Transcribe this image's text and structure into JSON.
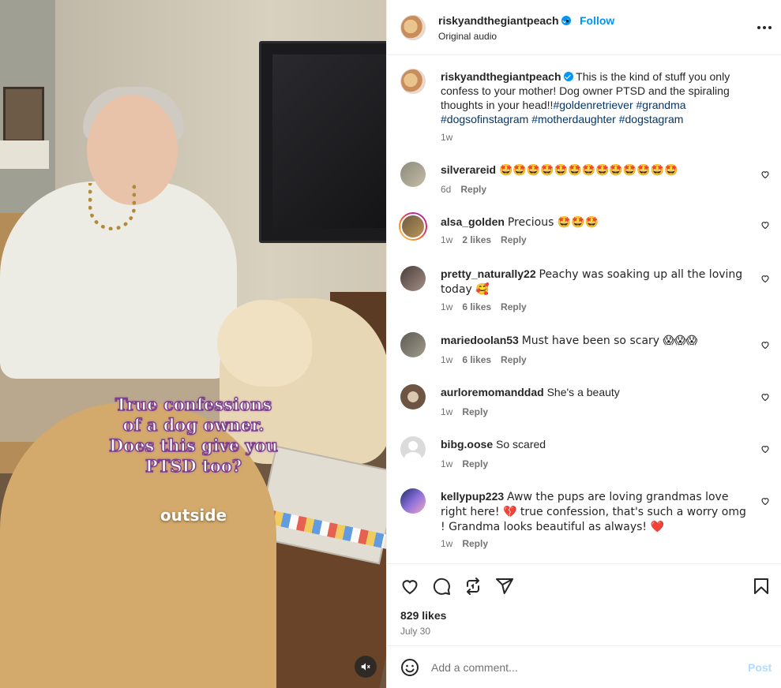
{
  "media": {
    "overlay_text": "True confessions\nof a dog owner.\nDoes this give you\nPTSD too?",
    "overlay_sub": "outside",
    "mute_icon": "speaker-muted-icon"
  },
  "header": {
    "username": "riskyandthegiantpeach",
    "dot": "•",
    "follow_label": "Follow",
    "audio_label": "Original audio"
  },
  "caption": {
    "username": "riskyandthegiantpeach",
    "text": "This is the kind of stuff you only confess to your mother! Dog owner PTSD and the spiraling thoughts in your head!!",
    "hashtags": [
      "#goldenretriever",
      "#grandma",
      "#dogsofinstagram",
      "#motherdaughter",
      "#dogstagram"
    ],
    "time": "1w"
  },
  "comments": [
    {
      "username": "silverareid",
      "text": "🤩🤩🤩🤩🤩🤩🤩🤩🤩🤩🤩🤩🤩",
      "time": "6d",
      "likes": "",
      "reply": "Reply"
    },
    {
      "username": "alsa_golden",
      "text": "Precious 🤩🤩🤩",
      "time": "1w",
      "likes": "2 likes",
      "reply": "Reply"
    },
    {
      "username": "pretty_naturally22",
      "text": "Peachy was soaking up all the loving today 🥰",
      "time": "1w",
      "likes": "6 likes",
      "reply": "Reply"
    },
    {
      "username": "mariedoolan53",
      "text": "Must have been so scary 😱😱😱",
      "time": "1w",
      "likes": "6 likes",
      "reply": "Reply"
    },
    {
      "username": "aurloremomanddad",
      "text": "She's a beauty",
      "time": "1w",
      "likes": "",
      "reply": "Reply"
    },
    {
      "username": "bibg.oose",
      "text": "So scared",
      "time": "1w",
      "likes": "",
      "reply": "Reply"
    },
    {
      "username": "kellypup223",
      "text": "Aww the pups are loving grandmas love right here! 💔 true confession, that's such a worry omg ! Grandma looks beautiful as always! ❤️",
      "time": "1w",
      "likes": "",
      "reply": "Reply"
    }
  ],
  "actions": {
    "icons": [
      "heart-icon",
      "comment-icon",
      "repost-icon",
      "share-icon",
      "bookmark-icon"
    ],
    "likes": "829 likes",
    "date": "July 30"
  },
  "add_comment": {
    "placeholder": "Add a comment...",
    "post_label": "Post"
  },
  "colors": {
    "link": "#0095f6",
    "hashtag": "#00376b",
    "muted": "#737373",
    "post_disabled": "#b3dbff",
    "overlay_stroke": "#7b3e8a"
  }
}
